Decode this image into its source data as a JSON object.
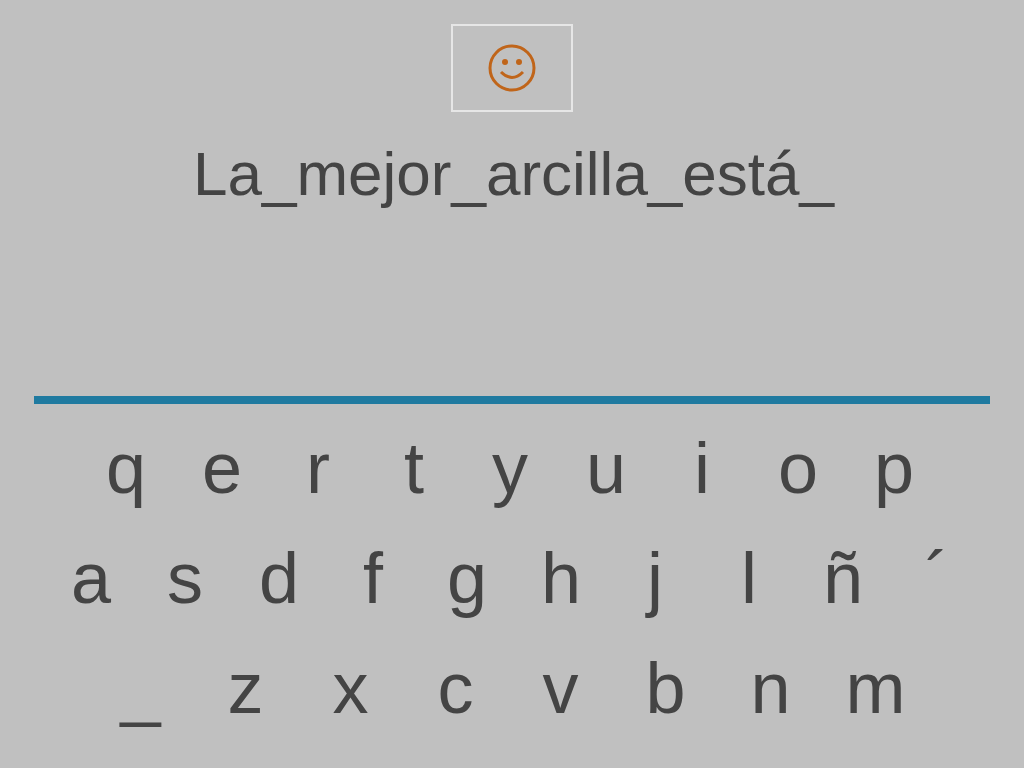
{
  "sentence": "La_mejor_arcilla_está_",
  "keyboard": {
    "rows": [
      [
        "q",
        "e",
        "r",
        "t",
        "y",
        "u",
        "i",
        "o",
        "p"
      ],
      [
        "a",
        "s",
        "d",
        "f",
        "g",
        "h",
        "j",
        "l",
        "ñ",
        "´"
      ],
      [
        "_",
        "z",
        "x",
        "c",
        "v",
        "b",
        "n",
        "m"
      ]
    ]
  }
}
